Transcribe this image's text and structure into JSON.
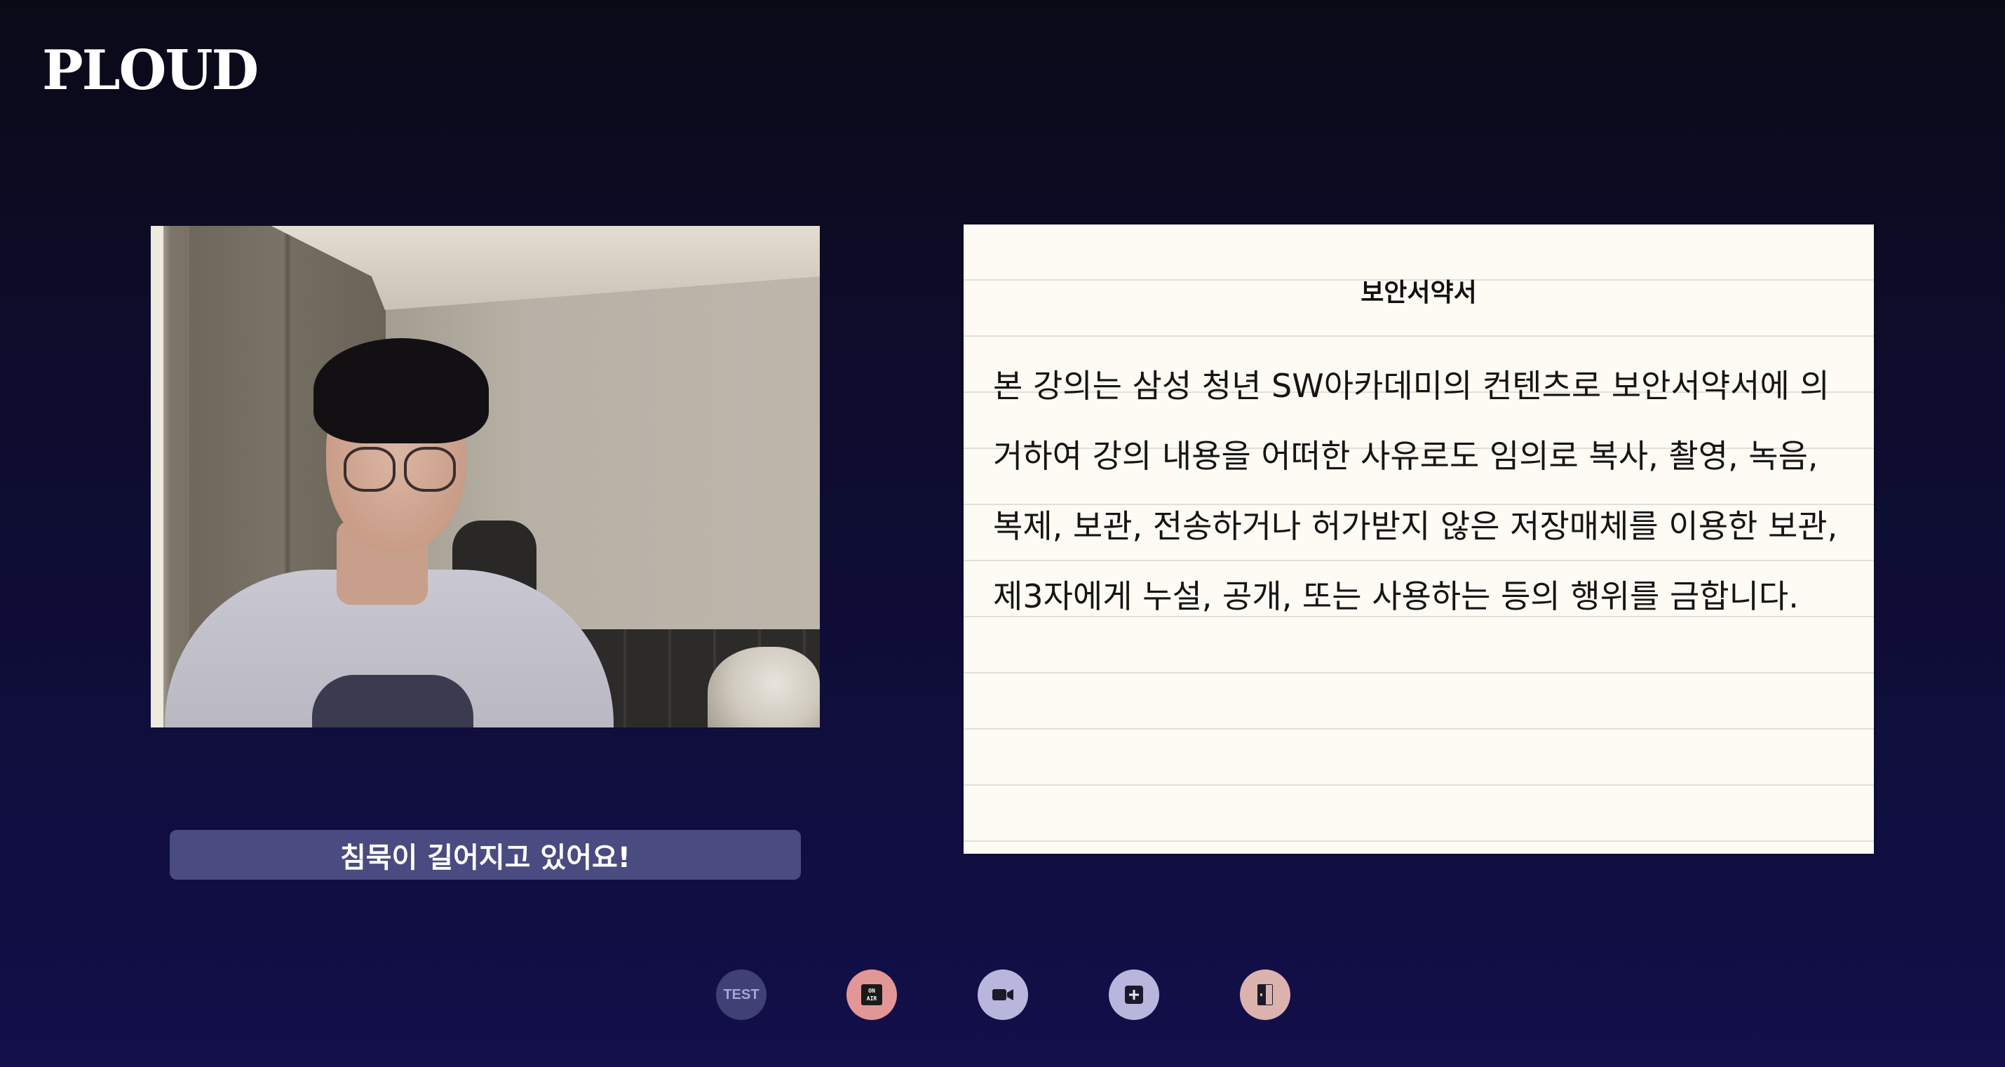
{
  "app": {
    "logo": "PLOUD"
  },
  "video": {
    "subtitle": "침묵이 길어지고 있어요!"
  },
  "script": {
    "title": "보안서약서",
    "body": "본 강의는 삼성 청년 SW아카데미의 컨텐츠로 보안서약서에 의거하여 강의 내용을 어떠한 사유로도 임의로 복사, 촬영, 녹음, 복제, 보관, 전송하거나 허가받지 않은 저장매체를 이용한 보관, 제3자에게 누설, 공개, 또는 사용하는 등의 행위를 금합니다."
  },
  "controls": {
    "test_label": "TEST",
    "onair_line1": "ON",
    "onair_line2": "AIR",
    "icons": [
      "video-camera-icon",
      "add-slide-icon",
      "exit-door-icon"
    ]
  },
  "colors": {
    "background_top": "#0a0a17",
    "background_bottom": "#120f4a",
    "subtitle_bar": "#4a4b80",
    "paper": "#fdfbf4",
    "onair": "#e39696",
    "exit": "#dcb2ae"
  }
}
